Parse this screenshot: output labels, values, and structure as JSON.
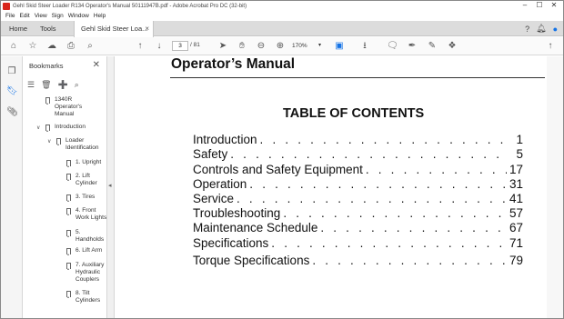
{
  "window": {
    "title": "Gehl Skid Steer Loader R134 Operator's Manual 50111947B.pdf - Adobe Acrobat Pro DC (32-bit)",
    "controls": [
      "–",
      "☐",
      "✕"
    ]
  },
  "menu": [
    "File",
    "Edit",
    "View",
    "Sign",
    "Window",
    "Help"
  ],
  "tabs": {
    "home": "Home",
    "tools": "Tools",
    "document": "Gehl Skid Steer Loa...",
    "close": "×"
  },
  "toolbar": {
    "current_page": "3",
    "total_pages": "/ 81",
    "zoom": "170%"
  },
  "bookmarks": {
    "header": "Bookmarks",
    "close": "✕",
    "items": [
      {
        "label": "1340R\nOperator's\nManual",
        "level": 0,
        "expanded": null
      },
      {
        "label": "Introduction",
        "level": 0,
        "expanded": true
      },
      {
        "label": "Loader\nIdentification",
        "level": 1,
        "expanded": true
      },
      {
        "label": "1. Upright",
        "level": 2,
        "expanded": null
      },
      {
        "label": "2. Lift\nCylinder",
        "level": 2,
        "expanded": null
      },
      {
        "label": "3. Tires",
        "level": 2,
        "expanded": null
      },
      {
        "label": "4. Front\nWork Lights",
        "level": 2,
        "expanded": null
      },
      {
        "label": "5.\nHandholds",
        "level": 2,
        "expanded": null
      },
      {
        "label": "6. Lift Arm",
        "level": 2,
        "expanded": null
      },
      {
        "label": "7. Auxiliary\nHydraulic\nCouplers",
        "level": 2,
        "expanded": null
      },
      {
        "label": "8. Tilt\nCylinders",
        "level": 2,
        "expanded": null
      }
    ]
  },
  "document": {
    "header": "Operator’s Manual",
    "toc_title": "TABLE OF CONTENTS",
    "toc": [
      {
        "label": "Introduction",
        "page": "1"
      },
      {
        "label": "Safety",
        "page": "5"
      },
      {
        "label": "Controls and Safety Equipment",
        "page": "17"
      },
      {
        "label": "Operation",
        "page": "31"
      },
      {
        "label": "Service",
        "page": "41"
      },
      {
        "label": "Troubleshooting",
        "page": "57"
      },
      {
        "label": "Maintenance Schedule",
        "page": "67"
      },
      {
        "label": "Specifications",
        "page": "71"
      },
      {
        "label": "Torque Specifications",
        "page": "79"
      }
    ]
  },
  "colors": {
    "accent": "#1473e6",
    "app_icon": "#d9261c",
    "tabbar": "#dcdcdc"
  },
  "icons": [
    "home-icon",
    "bookmark-star-icon",
    "upload-icon",
    "print-icon",
    "search-icon",
    "page-up-icon",
    "page-down-icon",
    "select-arrow-icon",
    "hand-icon",
    "zoom-out-icon",
    "zoom-in-icon",
    "page-view-icon",
    "scroll-mode-icon",
    "comment-icon",
    "pen-icon",
    "sign-icon",
    "tag-icon",
    "help-icon",
    "bell-icon",
    "user-icon",
    "share-icon"
  ]
}
